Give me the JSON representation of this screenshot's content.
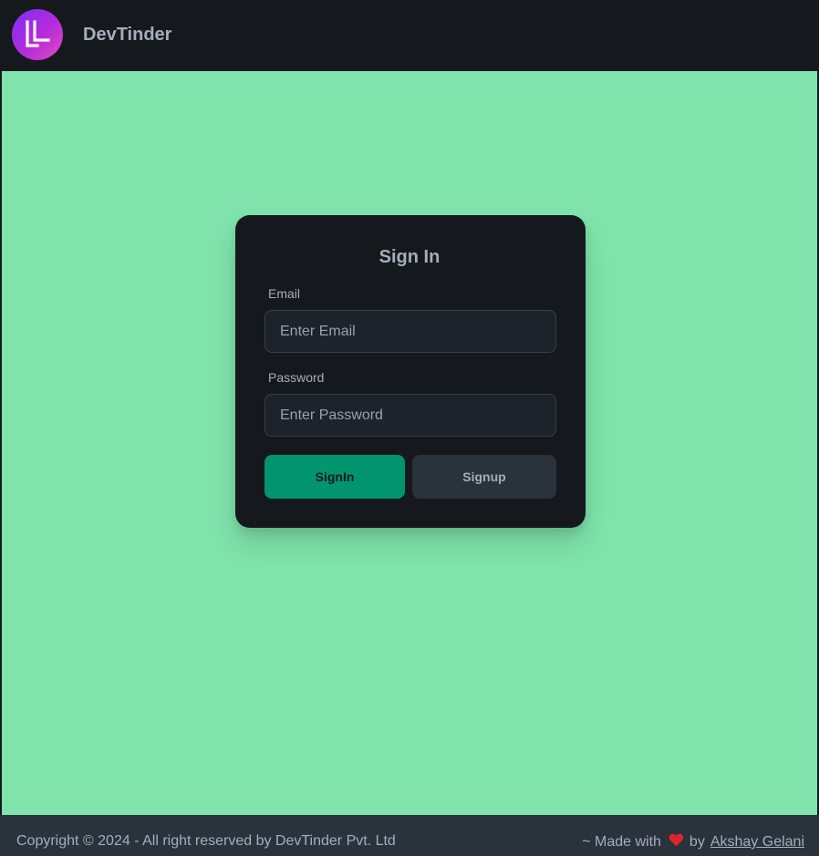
{
  "navbar": {
    "brand": "DevTinder",
    "logo_icon": "devtinder-logo-icon"
  },
  "login": {
    "title": "Sign In",
    "email_label": "Email",
    "email_placeholder": "Enter Email",
    "email_value": "",
    "password_label": "Password",
    "password_placeholder": "Enter Password",
    "password_value": "",
    "signin_button": "SignIn",
    "signup_button": "Signup"
  },
  "footer": {
    "copyright": "Copyright © 2024 - All right reserved by DevTinder Pvt. Ltd",
    "made_with": "~ Made with",
    "heart_icon": "heart-icon",
    "by": "by",
    "author": "Akshay Gelani"
  },
  "colors": {
    "background": "#7fe3ab",
    "navbar": "#15191e",
    "card": "#15191e",
    "primary_button": "#00956f",
    "secondary_button": "#2a323c",
    "footer": "#2a323c",
    "heart": "#e0242c"
  }
}
